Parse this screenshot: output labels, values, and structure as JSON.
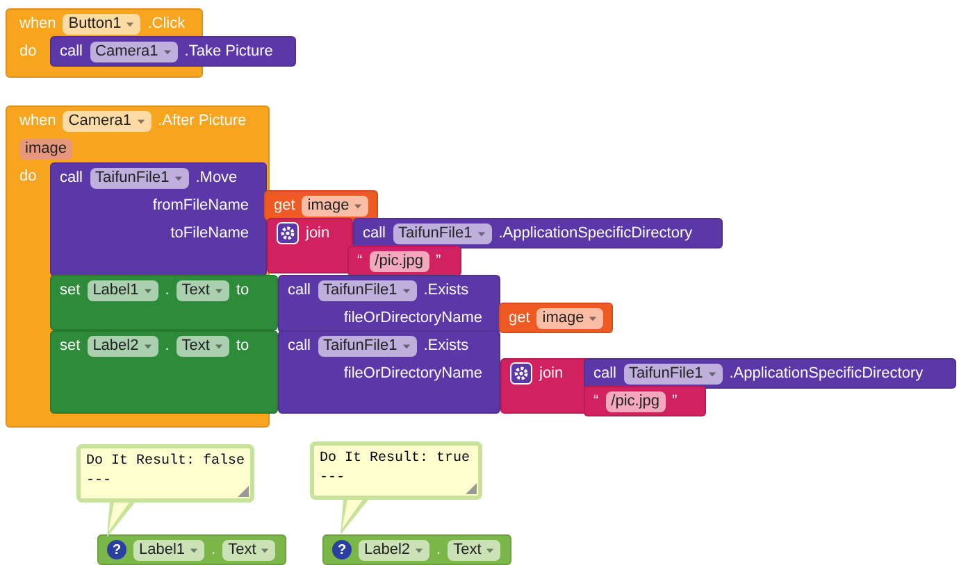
{
  "blocks": [
    {
      "kind": "event",
      "rows": [
        {
          "kind": "header",
          "tokens": [
            {
              "kind": "kw",
              "text": "when"
            },
            {
              "kind": "dd",
              "text": "Button1"
            },
            {
              "kind": "kw",
              "text": ".Click"
            }
          ]
        },
        {
          "kind": "header",
          "tokens": [
            {
              "kind": "kw",
              "text": "do"
            }
          ]
        }
      ]
    },
    {
      "kind": "method",
      "rows": [
        {
          "kind": "header",
          "tokens": [
            {
              "kind": "kw",
              "text": "call"
            },
            {
              "kind": "dd",
              "text": "Camera1"
            },
            {
              "kind": "kw",
              "text": ".Take Picture"
            }
          ]
        }
      ]
    },
    {
      "kind": "event",
      "rows": [
        {
          "kind": "header",
          "tokens": [
            {
              "kind": "kw",
              "text": "when"
            },
            {
              "kind": "dd",
              "text": "Camera1"
            },
            {
              "kind": "kw",
              "text": ".After Picture"
            }
          ]
        },
        {
          "kind": "header",
          "tokens": [
            {
              "kind": "param",
              "text": "image"
            }
          ]
        },
        {
          "kind": "header",
          "tokens": [
            {
              "kind": "kw",
              "text": "do"
            }
          ]
        }
      ]
    },
    {
      "kind": "method",
      "rows": [
        {
          "kind": "header",
          "tokens": [
            {
              "kind": "kw",
              "text": "call"
            },
            {
              "kind": "dd",
              "text": "TaifunFile1"
            },
            {
              "kind": "kw",
              "text": ".Move"
            }
          ]
        },
        {
          "kind": "socket",
          "tokens": [
            {
              "kind": "kw",
              "text": "fromFileName"
            }
          ]
        },
        {
          "kind": "socket",
          "tokens": [
            {
              "kind": "kw",
              "text": "toFileName"
            }
          ]
        }
      ]
    },
    {
      "kind": "get",
      "rows": [
        {
          "kind": "header",
          "tokens": [
            {
              "kind": "kw",
              "text": "get"
            },
            {
              "kind": "dd",
              "text": "image"
            }
          ]
        }
      ]
    },
    {
      "kind": "join",
      "rows": [
        {
          "kind": "header",
          "tokens": [
            {
              "kind": "gear"
            },
            {
              "kind": "kw",
              "text": "join"
            }
          ]
        }
      ]
    },
    {
      "kind": "method",
      "rows": [
        {
          "kind": "header",
          "tokens": [
            {
              "kind": "kw",
              "text": "call"
            },
            {
              "kind": "dd",
              "text": "TaifunFile1"
            },
            {
              "kind": "kw",
              "text": ".ApplicationSpecificDirectory"
            }
          ]
        }
      ]
    },
    {
      "kind": "text",
      "rows": [
        {
          "kind": "header",
          "tokens": [
            {
              "kind": "kw",
              "text": "“"
            },
            {
              "kind": "str",
              "text": "/pic.jpg"
            },
            {
              "kind": "kw",
              "text": "”"
            }
          ]
        }
      ]
    },
    {
      "kind": "set",
      "rows": [
        {
          "kind": "header",
          "tokens": [
            {
              "kind": "kw",
              "text": "set"
            },
            {
              "kind": "dd",
              "text": "Label1"
            },
            {
              "kind": "kw",
              "text": "."
            },
            {
              "kind": "dd",
              "text": "Text"
            },
            {
              "kind": "kw",
              "text": "to"
            }
          ]
        }
      ]
    },
    {
      "kind": "method",
      "rows": [
        {
          "kind": "header",
          "tokens": [
            {
              "kind": "kw",
              "text": "call"
            },
            {
              "kind": "dd",
              "text": "TaifunFile1"
            },
            {
              "kind": "kw",
              "text": ".Exists"
            }
          ]
        },
        {
          "kind": "socket",
          "tokens": [
            {
              "kind": "kw",
              "text": "fileOrDirectoryName"
            }
          ]
        }
      ]
    },
    {
      "kind": "get",
      "rows": [
        {
          "kind": "header",
          "tokens": [
            {
              "kind": "kw",
              "text": "get"
            },
            {
              "kind": "dd",
              "text": "image"
            }
          ]
        }
      ]
    },
    {
      "kind": "set",
      "rows": [
        {
          "kind": "header",
          "tokens": [
            {
              "kind": "kw",
              "text": "set"
            },
            {
              "kind": "dd",
              "text": "Label2"
            },
            {
              "kind": "kw",
              "text": "."
            },
            {
              "kind": "dd",
              "text": "Text"
            },
            {
              "kind": "kw",
              "text": "to"
            }
          ]
        }
      ]
    },
    {
      "kind": "method",
      "rows": [
        {
          "kind": "header",
          "tokens": [
            {
              "kind": "kw",
              "text": "call"
            },
            {
              "kind": "dd",
              "text": "TaifunFile1"
            },
            {
              "kind": "kw",
              "text": ".Exists"
            }
          ]
        },
        {
          "kind": "socket",
          "tokens": [
            {
              "kind": "kw",
              "text": "fileOrDirectoryName"
            }
          ]
        }
      ]
    },
    {
      "kind": "join",
      "rows": [
        {
          "kind": "header",
          "tokens": [
            {
              "kind": "gear"
            },
            {
              "kind": "kw",
              "text": "join"
            }
          ]
        }
      ]
    },
    {
      "kind": "method",
      "rows": [
        {
          "kind": "header",
          "tokens": [
            {
              "kind": "kw",
              "text": "call"
            },
            {
              "kind": "dd",
              "text": "TaifunFile1"
            },
            {
              "kind": "kw",
              "text": ".ApplicationSpecificDirectory"
            }
          ]
        }
      ]
    },
    {
      "kind": "text",
      "rows": [
        {
          "kind": "header",
          "tokens": [
            {
              "kind": "kw",
              "text": "“"
            },
            {
              "kind": "str",
              "text": "/pic.jpg"
            },
            {
              "kind": "kw",
              "text": "”"
            }
          ]
        }
      ]
    },
    {
      "kind": "getter",
      "rows": [
        {
          "kind": "header",
          "tokens": [
            {
              "kind": "help",
              "text": "?"
            },
            {
              "kind": "dd",
              "text": "Label1"
            },
            {
              "kind": "kw",
              "text": "."
            },
            {
              "kind": "dd",
              "text": "Text"
            }
          ]
        }
      ]
    },
    {
      "kind": "getter",
      "rows": [
        {
          "kind": "header",
          "tokens": [
            {
              "kind": "help",
              "text": "?"
            },
            {
              "kind": "dd",
              "text": "Label2"
            },
            {
              "kind": "kw",
              "text": "."
            },
            {
              "kind": "dd",
              "text": "Text"
            }
          ]
        }
      ]
    }
  ],
  "comments": [
    {
      "text": "Do It Result: false\n---"
    },
    {
      "text": "Do It Result: true\n---"
    }
  ]
}
